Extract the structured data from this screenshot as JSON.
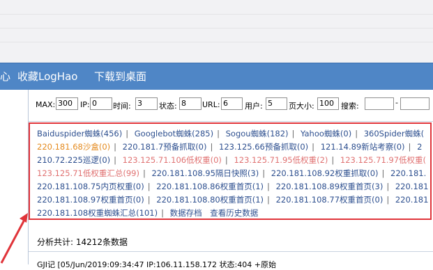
{
  "nav": {
    "items": [
      "心",
      "收藏LogHao",
      "下载到桌面"
    ]
  },
  "filters": [
    {
      "label": "MAX:",
      "value": "300"
    },
    {
      "label": "IP:",
      "value": "0"
    },
    {
      "label": "时间:",
      "value": "3"
    },
    {
      "label": "状态:",
      "value": "8"
    },
    {
      "label": "URL:",
      "value": "6"
    },
    {
      "label": "用户:",
      "value": "5"
    },
    {
      "label": "页大小:",
      "value": "100"
    },
    {
      "label": "搜索:",
      "value": ""
    }
  ],
  "links": {
    "row1": [
      "Baiduspider蜘蛛(456)",
      "Googlebot蜘蛛(285)",
      "Sogou蜘蛛(182)",
      "Yahoo蜘蛛(0)",
      "360Spider蜘蛛("
    ],
    "row2": [
      "220.181.68沙盒(0)",
      "220.181.7预备抓取(0)",
      "123.125.66预备抓取(0)",
      "121.14.89新站考察(0)",
      "2"
    ],
    "row3": [
      "210.72.225巡逻(0)",
      "123.125.71.106低权重(0)",
      "123.125.71.95低权重(2)",
      "123.125.71.97低权重("
    ],
    "row4": [
      "123.125.71低权重汇总(99)",
      "220.181.108.95隔日快照(3)",
      "220.181.108.92权重抓取(0)",
      "220.181."
    ],
    "row5": [
      "220.181.108.75内页权重(0)",
      "220.181.108.86权重首页(1)",
      "220.181.108.89权重首页(3)",
      "220.181"
    ],
    "row6": [
      "220.181.108.97权重首页(0)",
      "220.181.108.80权重首页(1)",
      "220.181.108.77权重首页(0)",
      "220.181"
    ],
    "row7": [
      "220.181.108权重蜘蛛汇总(101)",
      "数据存档",
      "查看历史数据"
    ]
  },
  "summary": {
    "total": "分析共计: 14212条数据"
  },
  "bottom": {
    "partial": "GJI记 [05/Jun/2019:09:34:47  IP:106.11.158.172  状态:404  +原始"
  },
  "colors": {
    "navbar": "#4f86c6",
    "link": "#2d4f8f",
    "orange": "#e48a1e",
    "red_link": "#e07272",
    "highlight_border": "#e0343a"
  }
}
